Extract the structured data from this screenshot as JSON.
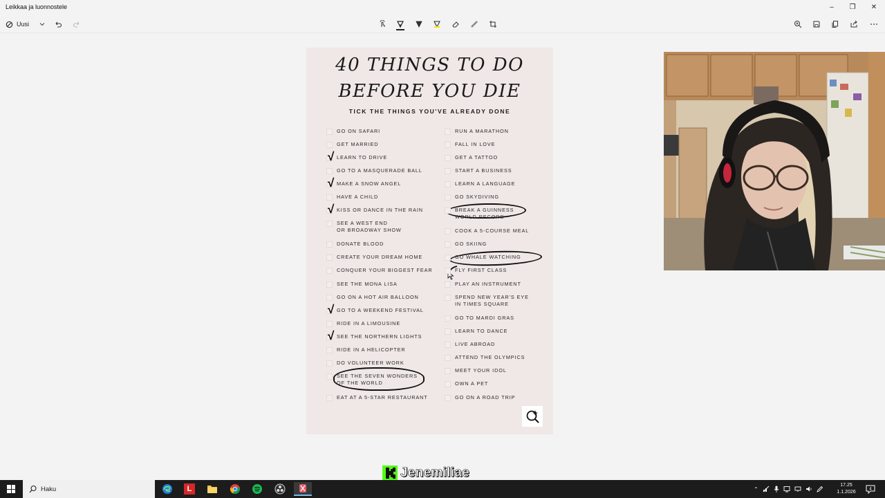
{
  "window": {
    "title": "Leikkaa ja luonnostele"
  },
  "toolbar": {
    "new_label": "Uusi"
  },
  "poster": {
    "title_line1": "40 THINGS TO DO",
    "title_line2": "BEFORE YOU DIE",
    "subtitle": "TICK THE THINGS YOU'VE ALREADY DONE",
    "left_items": [
      {
        "label": "GO ON SAFARI",
        "checked": false
      },
      {
        "label": "GET MARRIED",
        "checked": false
      },
      {
        "label": "LEARN TO DRIVE",
        "checked": true
      },
      {
        "label": "GO TO A MASQUERADE BALL",
        "checked": false
      },
      {
        "label": "MAKE A SNOW ANGEL",
        "checked": true
      },
      {
        "label": "HAVE A CHILD",
        "checked": false
      },
      {
        "label": "KISS OR DANCE IN THE RAIN",
        "checked": true
      },
      {
        "label": "SEE A WEST END\nOR BROADWAY SHOW",
        "checked": false
      },
      {
        "label": "DONATE BLOOD",
        "checked": false
      },
      {
        "label": "CREATE YOUR DREAM HOME",
        "checked": false
      },
      {
        "label": "CONQUER YOUR BIGGEST FEAR",
        "checked": false
      },
      {
        "label": "SEE THE MONA LISA",
        "checked": false
      },
      {
        "label": "GO ON A HOT AIR BALLOON",
        "checked": false
      },
      {
        "label": "GO TO A WEEKEND FESTIVAL",
        "checked": true
      },
      {
        "label": "RIDE IN A LIMOUSINE",
        "checked": false
      },
      {
        "label": "SEE THE NORTHERN LIGHTS",
        "checked": true
      },
      {
        "label": "RIDE IN A HELICOPTER",
        "checked": false
      },
      {
        "label": "DO VOLUNTEER WORK",
        "checked": false
      },
      {
        "label": "SEE THE SEVEN WONDERS\nOF THE WORLD",
        "checked": false,
        "circled": true
      },
      {
        "label": "EAT AT A 5-STAR RESTAURANT",
        "checked": false
      }
    ],
    "right_items": [
      {
        "label": "RUN A MARATHON",
        "checked": false
      },
      {
        "label": "FALL IN LOVE",
        "checked": false
      },
      {
        "label": "GET A TATTOO",
        "checked": false
      },
      {
        "label": "START A BUSINESS",
        "checked": false
      },
      {
        "label": "LEARN A LANGUAGE",
        "checked": false
      },
      {
        "label": "GO SKYDIVING",
        "checked": false
      },
      {
        "label": "BREAK A GUINNESS\nWORLD RECORD",
        "checked": false,
        "circled": true
      },
      {
        "label": "COOK A 5-COURSE MEAL",
        "checked": false
      },
      {
        "label": "GO SKIING",
        "checked": false
      },
      {
        "label": "GO WHALE WATCHING",
        "checked": false,
        "circled": true
      },
      {
        "label": "FLY FIRST CLASS",
        "checked": false
      },
      {
        "label": "PLAY AN INSTRUMENT",
        "checked": false
      },
      {
        "label": "SPEND NEW YEAR'S EYE\nIN TIMES SQUARE",
        "checked": false
      },
      {
        "label": "GO TO MARDI GRAS",
        "checked": false
      },
      {
        "label": "LEARN TO DANCE",
        "checked": false
      },
      {
        "label": "LIVE ABROAD",
        "checked": false
      },
      {
        "label": "ATTEND THE OLYMPICS",
        "checked": false
      },
      {
        "label": "MEET YOUR IDOL",
        "checked": false
      },
      {
        "label": "OWN A PET",
        "checked": false
      },
      {
        "label": "GO ON A ROAD TRIP",
        "checked": false
      }
    ]
  },
  "overlay": {
    "brand_name": "Jenemiliae"
  },
  "taskbar": {
    "search_label": "Haku",
    "time": "17.25",
    "date": "1.1.2026"
  }
}
